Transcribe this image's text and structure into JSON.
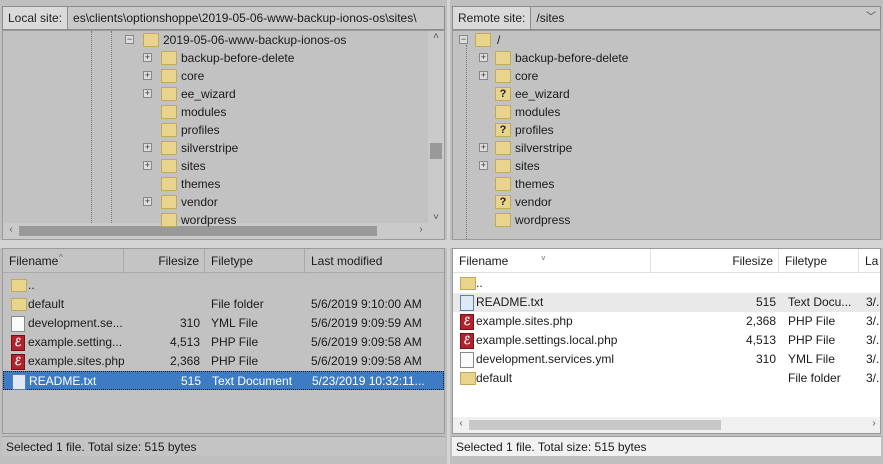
{
  "local": {
    "site_label": "Local site:",
    "site_path": "es\\clients\\optionshoppe\\2019-05-06-www-backup-ionos-os\\sites\\",
    "tree": {
      "root": "2019-05-06-www-backup-ionos-os",
      "items": [
        {
          "label": "backup-before-delete",
          "expandable": true
        },
        {
          "label": "core",
          "expandable": true
        },
        {
          "label": "ee_wizard",
          "expandable": true
        },
        {
          "label": "modules",
          "expandable": false
        },
        {
          "label": "profiles",
          "expandable": false
        },
        {
          "label": "silverstripe",
          "expandable": true
        },
        {
          "label": "sites",
          "expandable": true
        },
        {
          "label": "themes",
          "expandable": false
        },
        {
          "label": "vendor",
          "expandable": true
        },
        {
          "label": "wordpress",
          "expandable": false
        }
      ]
    },
    "columns": {
      "filename": "Filename",
      "filesize": "Filesize",
      "filetype": "Filetype",
      "last_modified": "Last modified"
    },
    "files": [
      {
        "name": "..",
        "size": "",
        "type": "",
        "modified": "",
        "icon": "folder-icon"
      },
      {
        "name": "default",
        "size": "",
        "type": "File folder",
        "modified": "5/6/2019 9:10:00 AM",
        "icon": "folder-icon"
      },
      {
        "name": "development.se...",
        "size": "310",
        "type": "YML File",
        "modified": "5/6/2019 9:09:59 AM",
        "icon": "yml-file-icon"
      },
      {
        "name": "example.setting...",
        "size": "4,513",
        "type": "PHP File",
        "modified": "5/6/2019 9:09:58 AM",
        "icon": "php-file-icon"
      },
      {
        "name": "example.sites.php",
        "size": "2,368",
        "type": "PHP File",
        "modified": "5/6/2019 9:09:58 AM",
        "icon": "php-file-icon"
      },
      {
        "name": "README.txt",
        "size": "515",
        "type": "Text Document",
        "modified": "5/23/2019 10:32:11...",
        "icon": "text-file-icon",
        "selected": true
      }
    ],
    "status": "Selected 1 file. Total size: 515 bytes"
  },
  "remote": {
    "site_label": "Remote site:",
    "site_path": "/sites",
    "tree": {
      "root": "/",
      "items": [
        {
          "label": "backup-before-delete",
          "expandable": true,
          "unknown": false
        },
        {
          "label": "core",
          "expandable": true,
          "unknown": false
        },
        {
          "label": "ee_wizard",
          "expandable": false,
          "unknown": true
        },
        {
          "label": "modules",
          "expandable": false,
          "unknown": false
        },
        {
          "label": "profiles",
          "expandable": false,
          "unknown": true
        },
        {
          "label": "silverstripe",
          "expandable": true,
          "unknown": false
        },
        {
          "label": "sites",
          "expandable": true,
          "unknown": false
        },
        {
          "label": "themes",
          "expandable": false,
          "unknown": false
        },
        {
          "label": "vendor",
          "expandable": false,
          "unknown": true
        },
        {
          "label": "wordpress",
          "expandable": false,
          "unknown": false
        }
      ]
    },
    "columns": {
      "filename": "Filename",
      "filesize": "Filesize",
      "filetype": "Filetype",
      "last_modified": "La"
    },
    "files": [
      {
        "name": "..",
        "size": "",
        "type": "",
        "modified": "",
        "icon": "folder-icon"
      },
      {
        "name": "README.txt",
        "size": "515",
        "type": "Text Docu...",
        "modified": "3/.",
        "icon": "text-file-icon",
        "highlight": true
      },
      {
        "name": "example.sites.php",
        "size": "2,368",
        "type": "PHP File",
        "modified": "3/.",
        "icon": "php-file-icon"
      },
      {
        "name": "example.settings.local.php",
        "size": "4,513",
        "type": "PHP File",
        "modified": "3/.",
        "icon": "php-file-icon"
      },
      {
        "name": "development.services.yml",
        "size": "310",
        "type": "YML File",
        "modified": "3/.",
        "icon": "yml-file-icon"
      },
      {
        "name": "default",
        "size": "",
        "type": "File folder",
        "modified": "3/.",
        "icon": "folder-icon"
      }
    ],
    "status": "Selected 1 file. Total size: 515 bytes"
  },
  "colors": {
    "selection": "#3d7cc4",
    "folder": "#e8d48a",
    "php": "#b0222c"
  }
}
